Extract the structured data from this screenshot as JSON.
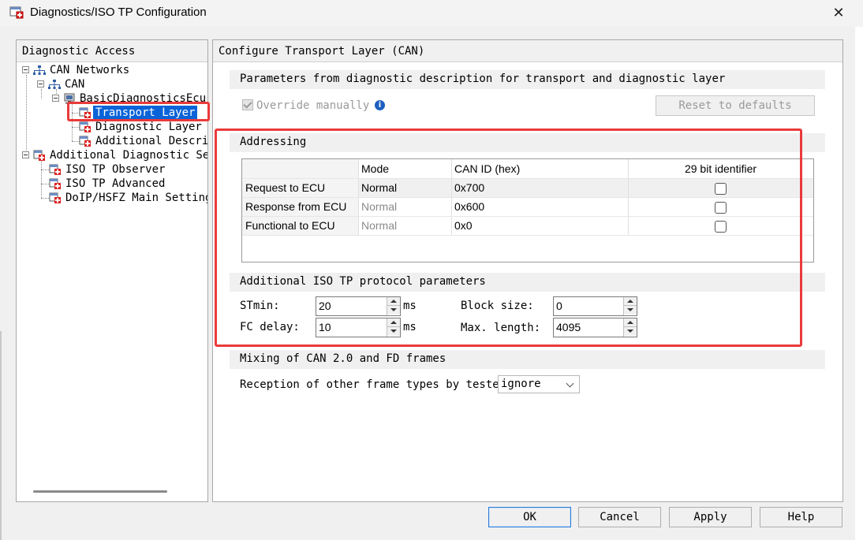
{
  "window": {
    "title": "Diagnostics/ISO TP Configuration",
    "close_glyph": "✕",
    "icon": "dialog-app-icon"
  },
  "left_panel": {
    "header": "Diagnostic Access",
    "tree": [
      {
        "label": "CAN Networks",
        "icon": "network-icon"
      },
      {
        "label": "CAN",
        "icon": "network-icon"
      },
      {
        "label": "BasicDiagnosticsEcu",
        "icon": "ecu-icon"
      },
      {
        "label": "Transport Layer",
        "icon": "settings-page-icon",
        "selected": true
      },
      {
        "label": "Diagnostic Layer",
        "icon": "settings-page-icon"
      },
      {
        "label": "Additional Descrip",
        "icon": "settings-page-icon"
      },
      {
        "label": "Additional Diagnostic Set",
        "icon": "settings-page-icon"
      },
      {
        "label": "ISO TP Observer",
        "icon": "settings-page-icon"
      },
      {
        "label": "ISO TP Advanced",
        "icon": "settings-page-icon"
      },
      {
        "label": "DoIP/HSFZ Main Settings",
        "icon": "settings-page-icon"
      }
    ]
  },
  "right_panel": {
    "header": "Configure Transport Layer (CAN)",
    "params_section": "Parameters from diagnostic description for transport and diagnostic layer",
    "override_label": "Override manually",
    "override_checked": true,
    "reset_button": "Reset to defaults",
    "addressing_section": "Addressing",
    "grid": {
      "columns": [
        "Mode",
        "CAN ID (hex)",
        "29 bit identifier"
      ],
      "rows": [
        {
          "name": "Request to ECU",
          "mode": "Normal",
          "can_id": "0x700",
          "bit29": false
        },
        {
          "name": "Response from ECU",
          "mode": "Normal",
          "can_id": "0x600",
          "bit29": false
        },
        {
          "name": "Functional to ECU",
          "mode": "Normal",
          "can_id": "0x0",
          "bit29": false
        }
      ]
    },
    "iso_tp_section": "Additional ISO TP protocol parameters",
    "stmin": {
      "label": "STmin:",
      "value": "20",
      "unit": "ms"
    },
    "fc_delay": {
      "label": "FC delay:",
      "value": "10",
      "unit": "ms"
    },
    "block_size": {
      "label": "Block size:",
      "value": "0"
    },
    "max_length": {
      "label": "Max. length:",
      "value": "4095"
    },
    "mixing_section": "Mixing of CAN 2.0 and FD frames",
    "reception_label": "Reception of other frame types by tester:",
    "reception_value": "ignore"
  },
  "buttons": {
    "ok": "OK",
    "cancel": "Cancel",
    "apply": "Apply",
    "help": "Help"
  },
  "colors": {
    "annotation_red": "#ea3a3a",
    "selection_blue": "#0a64d8",
    "info_blue": "#1c5fbf"
  }
}
